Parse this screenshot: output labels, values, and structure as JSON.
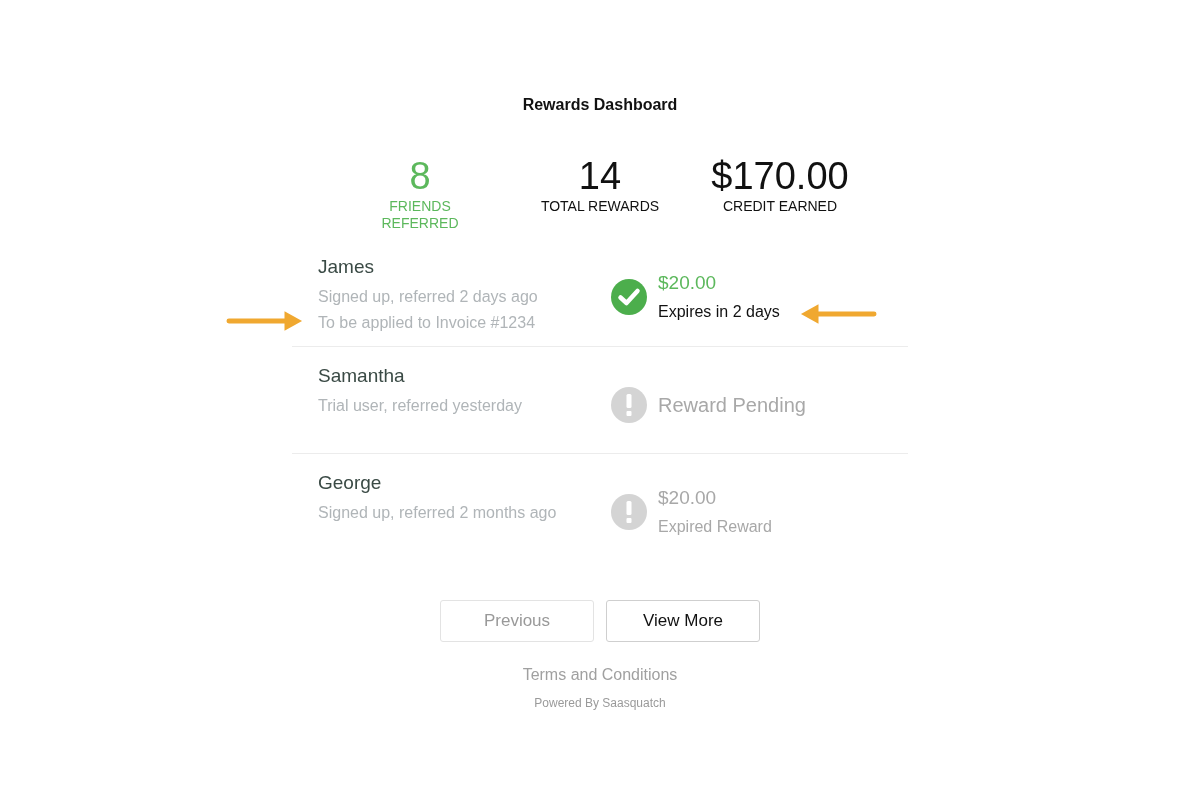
{
  "title": "Rewards Dashboard",
  "stats": [
    {
      "value": "8",
      "label": "FRIENDS REFERRED",
      "accent": true
    },
    {
      "value": "14",
      "label": "TOTAL REWARDS",
      "accent": false
    },
    {
      "value": "$170.00",
      "label": "CREDIT EARNED",
      "accent": false
    }
  ],
  "referrals": [
    {
      "name": "James",
      "details": [
        "Signed up, referred 2 days ago",
        "To be applied to Invoice #1234"
      ],
      "kind": "earned",
      "amount": "$20.00",
      "note": "Expires in 2 days",
      "highlighted": true
    },
    {
      "name": "Samantha",
      "details": [
        "Trial user, referred yesterday"
      ],
      "kind": "pending",
      "note": "Reward Pending",
      "highlighted": false
    },
    {
      "name": "George",
      "details": [
        "Signed up, referred 2 months ago"
      ],
      "kind": "expired",
      "amount": "$20.00",
      "note": "Expired Reward",
      "highlighted": false
    }
  ],
  "buttons": [
    {
      "label": "Previous",
      "disabled": true
    },
    {
      "label": "View More",
      "disabled": false
    }
  ],
  "terms_link": "Terms and Conditions",
  "powered_by": "Powered By Saasquatch"
}
